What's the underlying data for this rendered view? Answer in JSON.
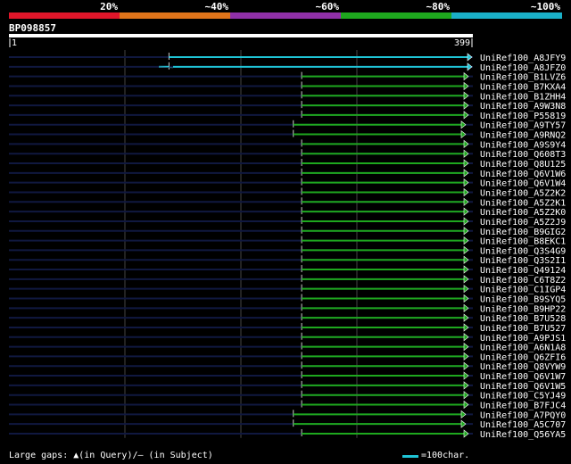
{
  "colors": {
    "bg": "#000000",
    "band": [
      "#e0162a",
      "#e0741a",
      "#9030a8",
      "#1ea81e",
      "#1ab0c8"
    ],
    "query_line": "#101840",
    "hit_green": "#1ea81e",
    "hit_cyan": "#1fc4d6",
    "grid": "#444444"
  },
  "header": {
    "identity_labels": [
      "20%",
      "~40%",
      "~60%",
      "~80%",
      "~100%"
    ],
    "query_id": "BP098857",
    "ruler_start": "1",
    "ruler_end": "399"
  },
  "hits": [
    {
      "id": "UniRef100_A8JFY9",
      "start": 0.345,
      "color": "cyan",
      "gap": false
    },
    {
      "id": "UniRef100_A8JFZ0",
      "start": 0.345,
      "color": "cyan",
      "gap": true
    },
    {
      "id": "UniRef100_B1LVZ6",
      "start": 0.631,
      "color": "green"
    },
    {
      "id": "UniRef100_B7KXA4",
      "start": 0.631,
      "color": "green"
    },
    {
      "id": "UniRef100_B1ZHH4",
      "start": 0.631,
      "color": "green"
    },
    {
      "id": "UniRef100_A9W3N8",
      "start": 0.631,
      "color": "green"
    },
    {
      "id": "UniRef100_P55819",
      "start": 0.631,
      "color": "green"
    },
    {
      "id": "UniRef100_A9TY57",
      "start": 0.613,
      "color": "green"
    },
    {
      "id": "UniRef100_A9RNQ2",
      "start": 0.613,
      "color": "green"
    },
    {
      "id": "UniRef100_A9S9Y4",
      "start": 0.631,
      "color": "green"
    },
    {
      "id": "UniRef100_Q608T3",
      "start": 0.631,
      "color": "green"
    },
    {
      "id": "UniRef100_Q8U125",
      "start": 0.631,
      "color": "green"
    },
    {
      "id": "UniRef100_Q6V1W6",
      "start": 0.631,
      "color": "green"
    },
    {
      "id": "UniRef100_Q6V1W4",
      "start": 0.631,
      "color": "green"
    },
    {
      "id": "UniRef100_A5Z2K2",
      "start": 0.631,
      "color": "green"
    },
    {
      "id": "UniRef100_A5Z2K1",
      "start": 0.631,
      "color": "green"
    },
    {
      "id": "UniRef100_A5Z2K0",
      "start": 0.631,
      "color": "green"
    },
    {
      "id": "UniRef100_A5Z2J9",
      "start": 0.631,
      "color": "green"
    },
    {
      "id": "UniRef100_B9GIG2",
      "start": 0.631,
      "color": "green"
    },
    {
      "id": "UniRef100_B8EKC1",
      "start": 0.631,
      "color": "green"
    },
    {
      "id": "UniRef100_Q3S4G9",
      "start": 0.631,
      "color": "green"
    },
    {
      "id": "UniRef100_Q3S2I1",
      "start": 0.631,
      "color": "green"
    },
    {
      "id": "UniRef100_Q49124",
      "start": 0.631,
      "color": "green"
    },
    {
      "id": "UniRef100_C6T8Z2",
      "start": 0.631,
      "color": "green"
    },
    {
      "id": "UniRef100_C1IGP4",
      "start": 0.631,
      "color": "green"
    },
    {
      "id": "UniRef100_B9SYQ5",
      "start": 0.631,
      "color": "green"
    },
    {
      "id": "UniRef100_B9HP22",
      "start": 0.631,
      "color": "green"
    },
    {
      "id": "UniRef100_B7U528",
      "start": 0.631,
      "color": "green"
    },
    {
      "id": "UniRef100_B7U527",
      "start": 0.631,
      "color": "green"
    },
    {
      "id": "UniRef100_A9PJS1",
      "start": 0.631,
      "color": "green"
    },
    {
      "id": "UniRef100_A6N1A8",
      "start": 0.631,
      "color": "green"
    },
    {
      "id": "UniRef100_Q6ZFI6",
      "start": 0.631,
      "color": "green"
    },
    {
      "id": "UniRef100_Q8VYW9",
      "start": 0.631,
      "color": "green"
    },
    {
      "id": "UniRef100_Q6V1W7",
      "start": 0.631,
      "color": "green"
    },
    {
      "id": "UniRef100_Q6V1W5",
      "start": 0.631,
      "color": "green"
    },
    {
      "id": "UniRef100_C5YJ49",
      "start": 0.631,
      "color": "green"
    },
    {
      "id": "UniRef100_B7FJC4",
      "start": 0.631,
      "color": "green"
    },
    {
      "id": "UniRef100_A7PQY0",
      "start": 0.613,
      "color": "green"
    },
    {
      "id": "UniRef100_A5C707",
      "start": 0.613,
      "color": "green"
    },
    {
      "id": "UniRef100_Q56YA5",
      "start": 0.631,
      "color": "green"
    }
  ],
  "footer": {
    "legend": "Large gaps: ▲(in Query)/— (in Subject)",
    "scale_label": "=100char."
  }
}
